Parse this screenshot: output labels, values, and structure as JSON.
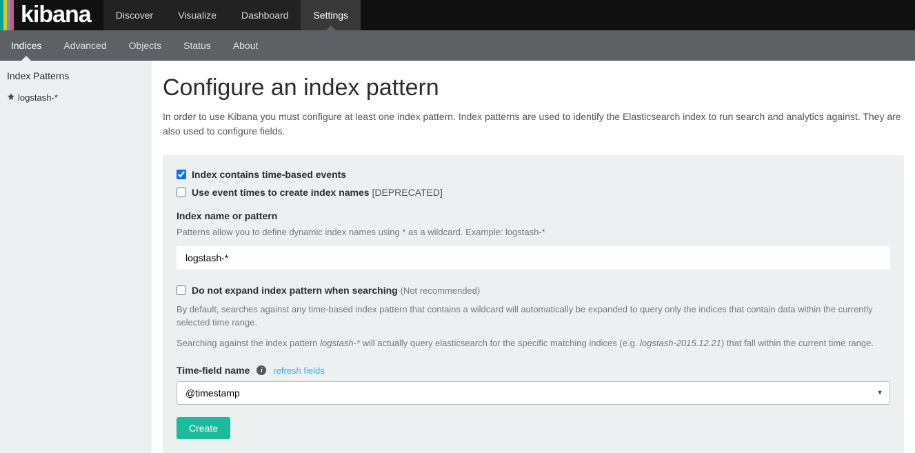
{
  "brand": "kibana",
  "topnav": {
    "items": [
      {
        "label": "Discover"
      },
      {
        "label": "Visualize"
      },
      {
        "label": "Dashboard"
      },
      {
        "label": "Settings"
      }
    ],
    "active_index": 3
  },
  "subnav": {
    "items": [
      {
        "label": "Indices"
      },
      {
        "label": "Advanced"
      },
      {
        "label": "Objects"
      },
      {
        "label": "Status"
      },
      {
        "label": "About"
      }
    ],
    "active_index": 0
  },
  "sidebar": {
    "heading": "Index Patterns",
    "items": [
      {
        "label": "logstash-*",
        "starred": true
      }
    ]
  },
  "page": {
    "title": "Configure an index pattern",
    "intro": "In order to use Kibana you must configure at least one index pattern. Index patterns are used to identify the Elasticsearch index to run search and analytics against. They are also used to configure fields."
  },
  "form": {
    "chk_time_based": {
      "label": "Index contains time-based events",
      "checked": true
    },
    "chk_event_times": {
      "label": "Use event times to create index names",
      "suffix": "[DEPRECATED]",
      "checked": false
    },
    "index_name": {
      "label": "Index name or pattern",
      "help": "Patterns allow you to define dynamic index names using * as a wildcard. Example: logstash-*",
      "value": "logstash-*"
    },
    "chk_no_expand": {
      "label": "Do not expand index pattern when searching",
      "suffix": "(Not recommended)",
      "checked": false
    },
    "help_default_prefix": "By default, searches against any time-based index pattern that contains a wildcard will automatically be expanded to query only the indices that contain data within the currently selected time range.",
    "help_search_prefix": "Searching against the index pattern ",
    "help_search_pattern": "logstash-*",
    "help_search_mid": " will actually query elasticsearch for the specific matching indices (e.g. ",
    "help_search_example": "logstash-2015.12.21",
    "help_search_suffix": ") that fall within the current time range.",
    "time_field": {
      "label": "Time-field name",
      "refresh": "refresh fields",
      "value": "@timestamp"
    },
    "create_label": "Create"
  }
}
